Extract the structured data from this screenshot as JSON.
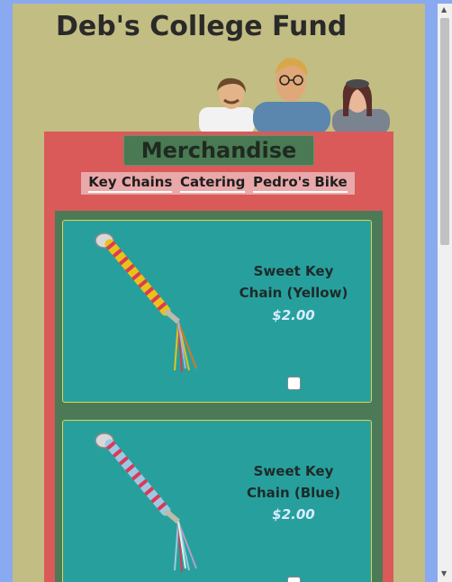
{
  "site": {
    "title": "Deb's College Fund"
  },
  "merch": {
    "title": "Merchandise",
    "nav": [
      "Key Chains",
      "Catering",
      "Pedro's Bike"
    ]
  },
  "products": [
    {
      "name": "Sweet Key Chain (Yellow)",
      "price": "$2.00",
      "checked": false
    },
    {
      "name": "Sweet Key Chain (Blue)",
      "price": "$2.00",
      "checked": false
    }
  ],
  "colors": {
    "page_bg": "#c2bd82",
    "panel": "#d95a59",
    "card": "#27a09d",
    "card_border": "#e5d24a"
  },
  "icons": {
    "scroll_up": "triangle-up",
    "scroll_down": "triangle-down"
  }
}
